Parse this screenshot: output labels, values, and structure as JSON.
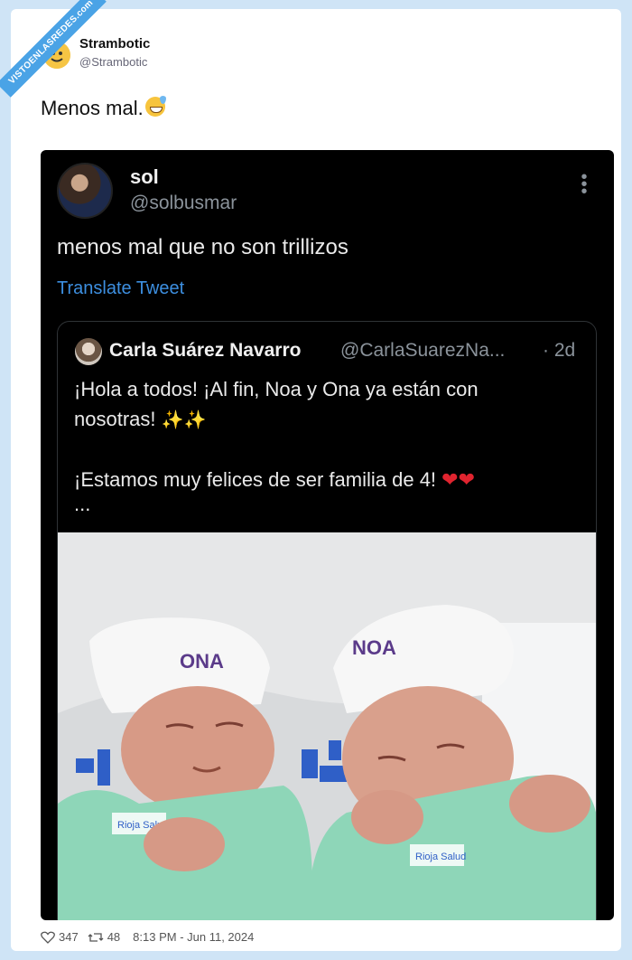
{
  "watermark": "VISTOENLASREDES.com",
  "author": {
    "name": "Strambotic",
    "handle": "@Strambotic"
  },
  "post": {
    "text": "Menos mal.",
    "emoji": "sweat-smile-emoji"
  },
  "embedded_tweet": {
    "name": "sol",
    "handle": "@solbusmar",
    "text": "menos mal que no son trillizos",
    "translate_label": "Translate Tweet",
    "quoted": {
      "name": "Carla Suárez Navarro",
      "handle": "@CarlaSuarezNa...",
      "time": "· 2d",
      "line1": "¡Hola a todos! ¡Al fin, Noa y Ona ya están con",
      "line2": "nosotras!",
      "line3": "¡Estamos muy felices de ser familia de 4!",
      "ellipsis": "...",
      "photo": {
        "cap_left": "ONA",
        "cap_right": "NOA",
        "badge_left": "Rioja Salud",
        "badge_right": "Rioja Salud"
      }
    }
  },
  "footer": {
    "likes": "347",
    "retweets": "48",
    "timestamp": "8:13 PM - Jun 11, 2024"
  },
  "colors": {
    "page_bg": "#cfe4f6",
    "link_blue": "#3d8fe0",
    "embed_bg": "#000000",
    "onesie_green": "#8ed6b8"
  }
}
